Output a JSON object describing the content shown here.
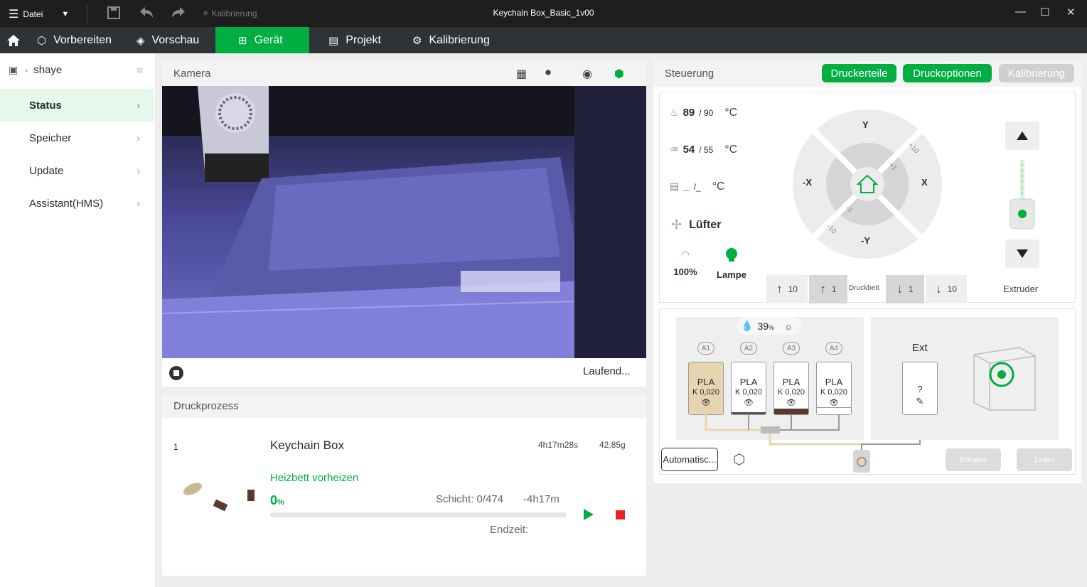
{
  "titlebar": {
    "menu_label": "Datei",
    "calibration_label": "Kalibrierung",
    "window_title": "Keychain Box_Basic_1v00"
  },
  "tabs": [
    {
      "label": "Vorbereiten"
    },
    {
      "label": "Vorschau"
    },
    {
      "label": "Gerät"
    },
    {
      "label": "Projekt"
    },
    {
      "label": "Kalibrierung"
    }
  ],
  "sidebar": {
    "user": "shaye",
    "items": [
      {
        "label": "Status"
      },
      {
        "label": "Speicher"
      },
      {
        "label": "Update"
      },
      {
        "label": "Assistant(HMS)"
      }
    ]
  },
  "camera": {
    "title": "Kamera",
    "status": "Laufend..."
  },
  "print": {
    "title": "Druckprozess",
    "plate_number": "1",
    "job_name": "Keychain Box",
    "duration": "4h17m28s",
    "weight": "42,85g",
    "stage": "Heizbett vorheizen",
    "progress_value": "0",
    "progress_unit": "%",
    "progress_fraction": 0,
    "layer": "Schicht: 0/474",
    "remaining": "-4h17m",
    "end_time_label": "Endzeit:"
  },
  "control": {
    "title": "Steuerung",
    "btn_parts": "Druckerteile",
    "btn_options": "Druckoptionen",
    "btn_calib": "Kalibrierung",
    "nozzle_temp": "89",
    "nozzle_target": "/ 90",
    "bed_temp": "54",
    "bed_target": "/ 55",
    "chamber_temp": "_",
    "chamber_target": "/_",
    "unit": "°C",
    "fan_label": "Lüfter",
    "speed_value": "100%",
    "lamp_label": "Lampe",
    "jog": {
      "y_plus": "Y",
      "y_minus": "-Y",
      "x_plus": "X",
      "x_minus": "-X",
      "p10": "+10",
      "p1": "+1",
      "m1": "-1",
      "m10": "-10"
    },
    "bed_buttons": [
      {
        "label": "10"
      },
      {
        "label": "1"
      },
      {
        "label": "1"
      },
      {
        "label": "10"
      }
    ],
    "bed_label": "Druckbett",
    "extruder_label": "Extruder"
  },
  "ams": {
    "humidity": "39",
    "humidity_unit": "%",
    "slots": [
      {
        "id": "A1",
        "type": "PLA",
        "k": "K 0,020",
        "color": "#e6d5b0"
      },
      {
        "id": "A2",
        "type": "PLA",
        "k": "K 0,020",
        "color": "#555555"
      },
      {
        "id": "A3",
        "type": "PLA",
        "k": "K 0,020",
        "color": "#5a3a2e"
      },
      {
        "id": "A4",
        "type": "PLA",
        "k": "K 0,020",
        "color": "#ffffff"
      }
    ],
    "ext_label": "Ext",
    "ext_type": "?",
    "auto_btn": "Automatisc...",
    "unload_btn": "Entladen",
    "load_btn": "Laden"
  },
  "colors": {
    "accent": "#00ae42",
    "tabbar": "#2e3337",
    "titlebar": "#1e1e1e"
  }
}
